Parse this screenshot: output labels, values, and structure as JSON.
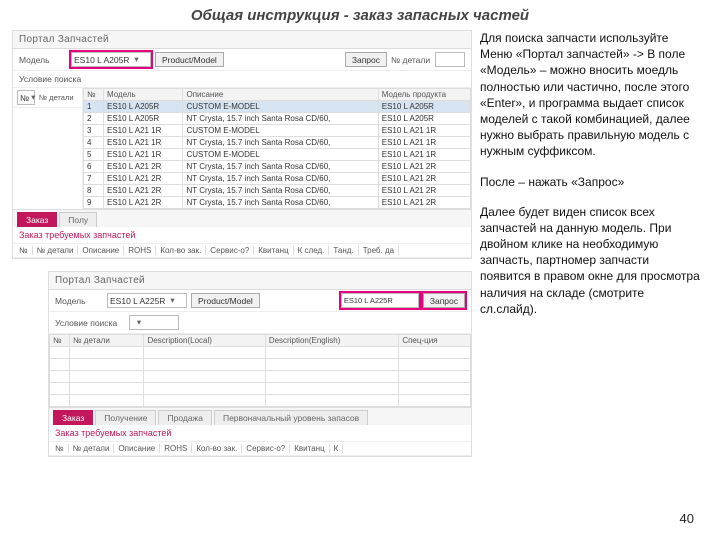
{
  "slide": {
    "title": "Общая инструкция - заказ запасных частей",
    "pagenum": "40"
  },
  "explain": {
    "p1": "Для поиска запчасти используйте Меню «Портал запчастей» -> В поле «Модель» – можно вносить моедль полностью или частично, после этого «Enter», и программа выдает список моделей с такой комбинацией, далее нужно выбрать правильную модель с нужным суффиксом.",
    "p2": "После – нажать «Запрос»",
    "p3": "Далее будет виден список всех запчастей на данную модель. При двойном клике на необходимую запчасть, партномер запчасти появится в правом окне для просмотра наличия на складе (смотрите сл.слайд)."
  },
  "portalTitle": "Портал Запчастей",
  "top": {
    "modelLbl": "Модель",
    "modelVal": "ES10 L A205R",
    "prodBtn": "Product/Model",
    "queryBtn": "Запрос",
    "partLbl": "№ детали",
    "searchCondLbl": "Условие поиска",
    "cols": {
      "n": "№",
      "model": "Модель",
      "desc": "Описание",
      "prod": "Модель продукта"
    },
    "rows": [
      {
        "n": "1",
        "m": "ES10 L A205R",
        "d": "CUSTOM E-MODEL",
        "p": "ES10 L A205R"
      },
      {
        "n": "2",
        "m": "ES10 L A205R",
        "d": "NT Crysta, 15.7 inch Santa Rosa CD/60,",
        "p": "ES10 L A205R"
      },
      {
        "n": "3",
        "m": "ES10 L A21 1R",
        "d": "CUSTOM E-MODEL",
        "p": "ES10 L A21 1R"
      },
      {
        "n": "4",
        "m": "ES10 L A21 1R",
        "d": "NT Crysta, 15.7 inch Santa Rosa CD/60,",
        "p": "ES10 L A21 1R"
      },
      {
        "n": "5",
        "m": "ES10 L A21 1R",
        "d": "CUSTOM E-MODEL",
        "p": "ES10 L A21 1R"
      },
      {
        "n": "6",
        "m": "ES10 L A21 2R",
        "d": "NT Crysta, 15.7 inch Santa Rosa CD/60,",
        "p": "ES10 L A21 2R"
      },
      {
        "n": "7",
        "m": "ES10 L A21 2R",
        "d": "NT Crysta, 15.7 inch Santa Rosa CD/60,",
        "p": "ES10 L A21 2R"
      },
      {
        "n": "8",
        "m": "ES10 L A21 2R",
        "d": "NT Crysta, 15.7 inch Santa Rosa CD/60,",
        "p": "ES10 L A21 2R"
      },
      {
        "n": "9",
        "m": "ES10 L A21 2R",
        "d": "NT Crysta, 15.7 inch Santa Rosa CD/60,",
        "p": "ES10 L A21 2R"
      }
    ],
    "sideLbl": "№ детали",
    "sideDD": "№",
    "tabs": {
      "order": "Заказ",
      "recv": "Полу"
    },
    "reqTitle": "Заказ требуемых запчастей",
    "reqCols": [
      "№",
      "№ детали",
      "Описание",
      "ROHS",
      "Кол-во зак.",
      "Сервис-о?",
      "Квитанц",
      "К след.",
      "Танд.",
      "Треб. да"
    ]
  },
  "bottom": {
    "modelVal": "ES10 L A225R",
    "prodBtn": "Product/Model",
    "queryBtn": "Запрос",
    "searchCondLbl": "Условие поиска",
    "cols": {
      "n": "№",
      "part": "№ детали",
      "dL": "Description(Local)",
      "dE": "Description(English)",
      "spec": "Спец-ция"
    },
    "tabs": {
      "order": "Заказ",
      "recv": "Получение",
      "sale": "Продажа",
      "init": "Первоначальный уровень запасов"
    },
    "reqTitle": "Заказ требуемых запчастей",
    "reqCols": [
      "№",
      "№ детали",
      "Описание",
      "ROHS",
      "Кол-во зак.",
      "Сервис-о?",
      "Квитанц",
      "К"
    ]
  }
}
